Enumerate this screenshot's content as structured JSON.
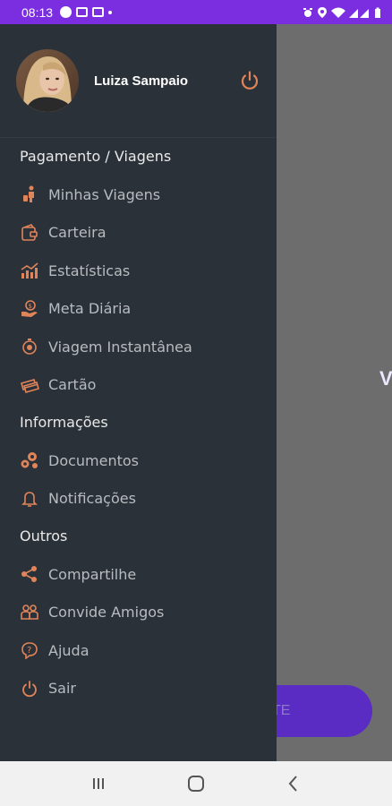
{
  "status_bar": {
    "time": "08:13",
    "icons": [
      "circle-notification-icon",
      "image-icon",
      "gallery-icon",
      "dot-icon",
      "alarm-icon",
      "location-icon",
      "wifi-icon",
      "signal-icon",
      "battery-icon"
    ]
  },
  "colors": {
    "status_bar": "#7a2ee0",
    "drawer_bg": "#2b3138",
    "accent": "#e0845a",
    "nav_bg": "#f1f1f1"
  },
  "profile": {
    "name": "Luiza Sampaio"
  },
  "menu": {
    "sections": [
      {
        "title": "Pagamento / Viagens",
        "items": [
          {
            "label": "Minhas Viagens",
            "icon": "person-trips-icon"
          },
          {
            "label": "Carteira",
            "icon": "wallet-icon"
          },
          {
            "label": "Estatísticas",
            "icon": "statistics-chart-icon"
          },
          {
            "label": "Meta Diária",
            "icon": "daily-goal-icon"
          },
          {
            "label": "Viagem Instantânea",
            "icon": "instant-trip-icon"
          },
          {
            "label": "Cartão",
            "icon": "card-icon"
          }
        ]
      },
      {
        "title": "Informações",
        "items": [
          {
            "label": "Documentos",
            "icon": "gears-icon"
          },
          {
            "label": "Notificações",
            "icon": "bell-icon"
          }
        ]
      },
      {
        "title": "Outros",
        "items": [
          {
            "label": "Compartilhe",
            "icon": "share-icon"
          },
          {
            "label": "Convide Amigos",
            "icon": "invite-friends-icon"
          },
          {
            "label": "Ajuda",
            "icon": "help-icon"
          },
          {
            "label": "Sair",
            "icon": "power-icon"
          }
        ]
      }
    ]
  },
  "background": {
    "button_label": "TE",
    "mark": "V"
  }
}
